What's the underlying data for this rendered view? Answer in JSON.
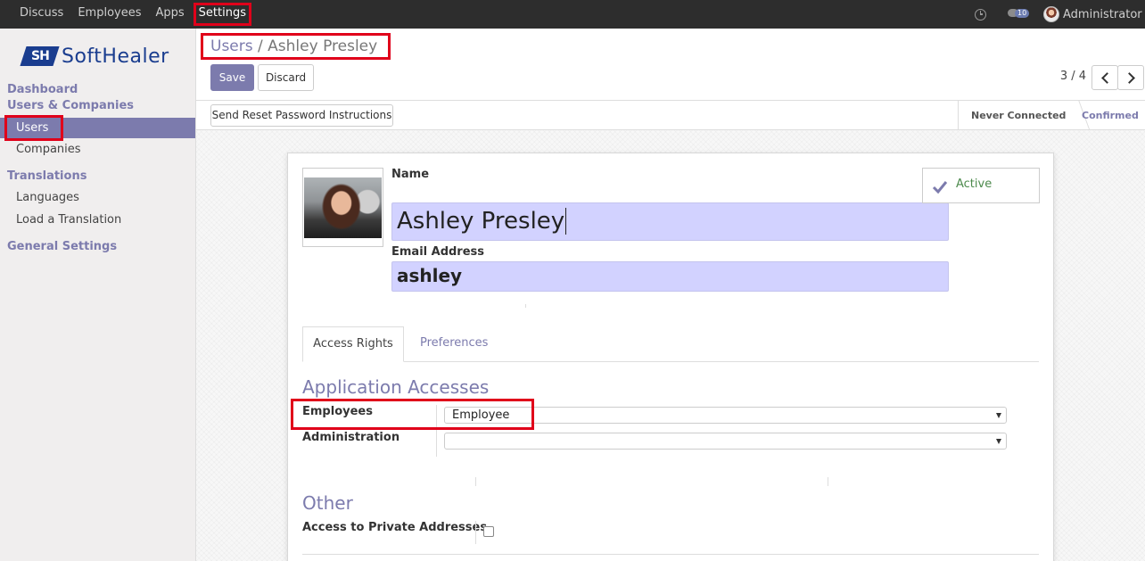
{
  "topbar": {
    "menu": [
      "Discuss",
      "Employees",
      "Apps",
      "Settings"
    ],
    "notification_count": "10",
    "user_name": "Administrator"
  },
  "sidebar": {
    "logo_text": "SoftHealer",
    "logo_mark": "SH",
    "sections": {
      "dashboard": "Dashboard",
      "users_companies": "Users & Companies",
      "users": "Users",
      "companies": "Companies",
      "translations": "Translations",
      "languages": "Languages",
      "load_translation": "Load a Translation",
      "general_settings": "General Settings"
    }
  },
  "control": {
    "breadcrumb_parent": "Users",
    "breadcrumb_sep": "/",
    "breadcrumb_current": "Ashley Presley",
    "save_label": "Save",
    "discard_label": "Discard",
    "pager": "3 / 4"
  },
  "statusbar": {
    "reset_button": "Send Reset Password Instructions",
    "steps": [
      "Never Connected",
      "Confirmed"
    ]
  },
  "form": {
    "name_label": "Name",
    "name_value": "Ashley Presley",
    "email_label": "Email Address",
    "email_value": "ashley",
    "active_label": "Active",
    "tabs": [
      "Access Rights",
      "Preferences"
    ],
    "app_access_title": "Application Accesses",
    "employees_label": "Employees",
    "employees_value": "Employee",
    "administration_label": "Administration",
    "administration_value": "",
    "other_title": "Other",
    "private_addresses_label": "Access to Private Addresses"
  },
  "colors": {
    "accent": "#7c7bad",
    "highlight": "#e0001a",
    "input_bg": "#d2d2ff",
    "navbar": "#2d2d2d"
  }
}
